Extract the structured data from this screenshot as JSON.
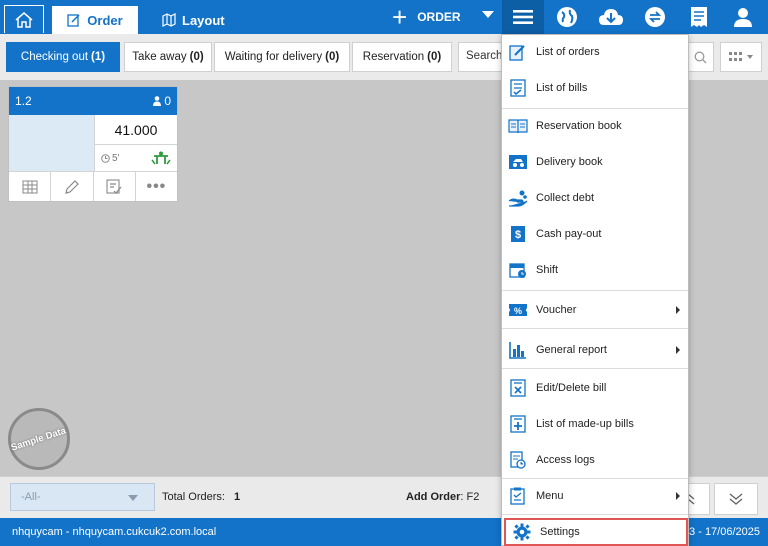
{
  "topbar": {
    "order_tab": "Order",
    "layout_tab": "Layout",
    "order_button": "ORDER"
  },
  "filters": {
    "tabs": [
      {
        "label": "Checking out",
        "count": "(1)"
      },
      {
        "label": "Take away",
        "count": "(0)"
      },
      {
        "label": "Waiting for delivery",
        "count": "(0)"
      },
      {
        "label": "Reservation",
        "count": "(0)"
      }
    ],
    "search_label": "Search"
  },
  "table_card": {
    "name": "1.2",
    "guests": "0",
    "amount": "41.000",
    "elapsed": "5'"
  },
  "stamp": {
    "text": "Sample Data"
  },
  "bottom": {
    "area_select": "-All-",
    "total_orders_label": "Total Orders:",
    "total_orders_value": "1",
    "add_order_label": "Add Order",
    "add_order_key": ": F2"
  },
  "statusbar": {
    "user": "nhquycam - nhquycam.cukcuk2.com.local",
    "date": "3 - 17/06/2025"
  },
  "menu": {
    "items": [
      {
        "label": "List of orders",
        "icon": "edit-list-icon"
      },
      {
        "label": "List of bills",
        "icon": "bill-list-icon"
      },
      {
        "label": "Reservation book",
        "icon": "book-icon"
      },
      {
        "label": "Delivery book",
        "icon": "delivery-icon"
      },
      {
        "label": "Collect debt",
        "icon": "coin-hand-icon"
      },
      {
        "label": "Cash pay-out",
        "icon": "cash-icon"
      },
      {
        "label": "Shift",
        "icon": "calendar-shift-icon"
      },
      {
        "label": "Voucher",
        "icon": "voucher-icon"
      },
      {
        "label": "General report",
        "icon": "bar-chart-icon"
      },
      {
        "label": "Edit/Delete bill",
        "icon": "delete-bill-icon"
      },
      {
        "label": "List of made-up bills",
        "icon": "add-bill-icon"
      },
      {
        "label": "Access logs",
        "icon": "log-icon"
      },
      {
        "label": "Menu",
        "icon": "menu-book-icon"
      },
      {
        "label": "Settings",
        "icon": "gear-icon"
      }
    ]
  },
  "colors": {
    "primary": "#1373c8",
    "highlight": "#e05555"
  }
}
